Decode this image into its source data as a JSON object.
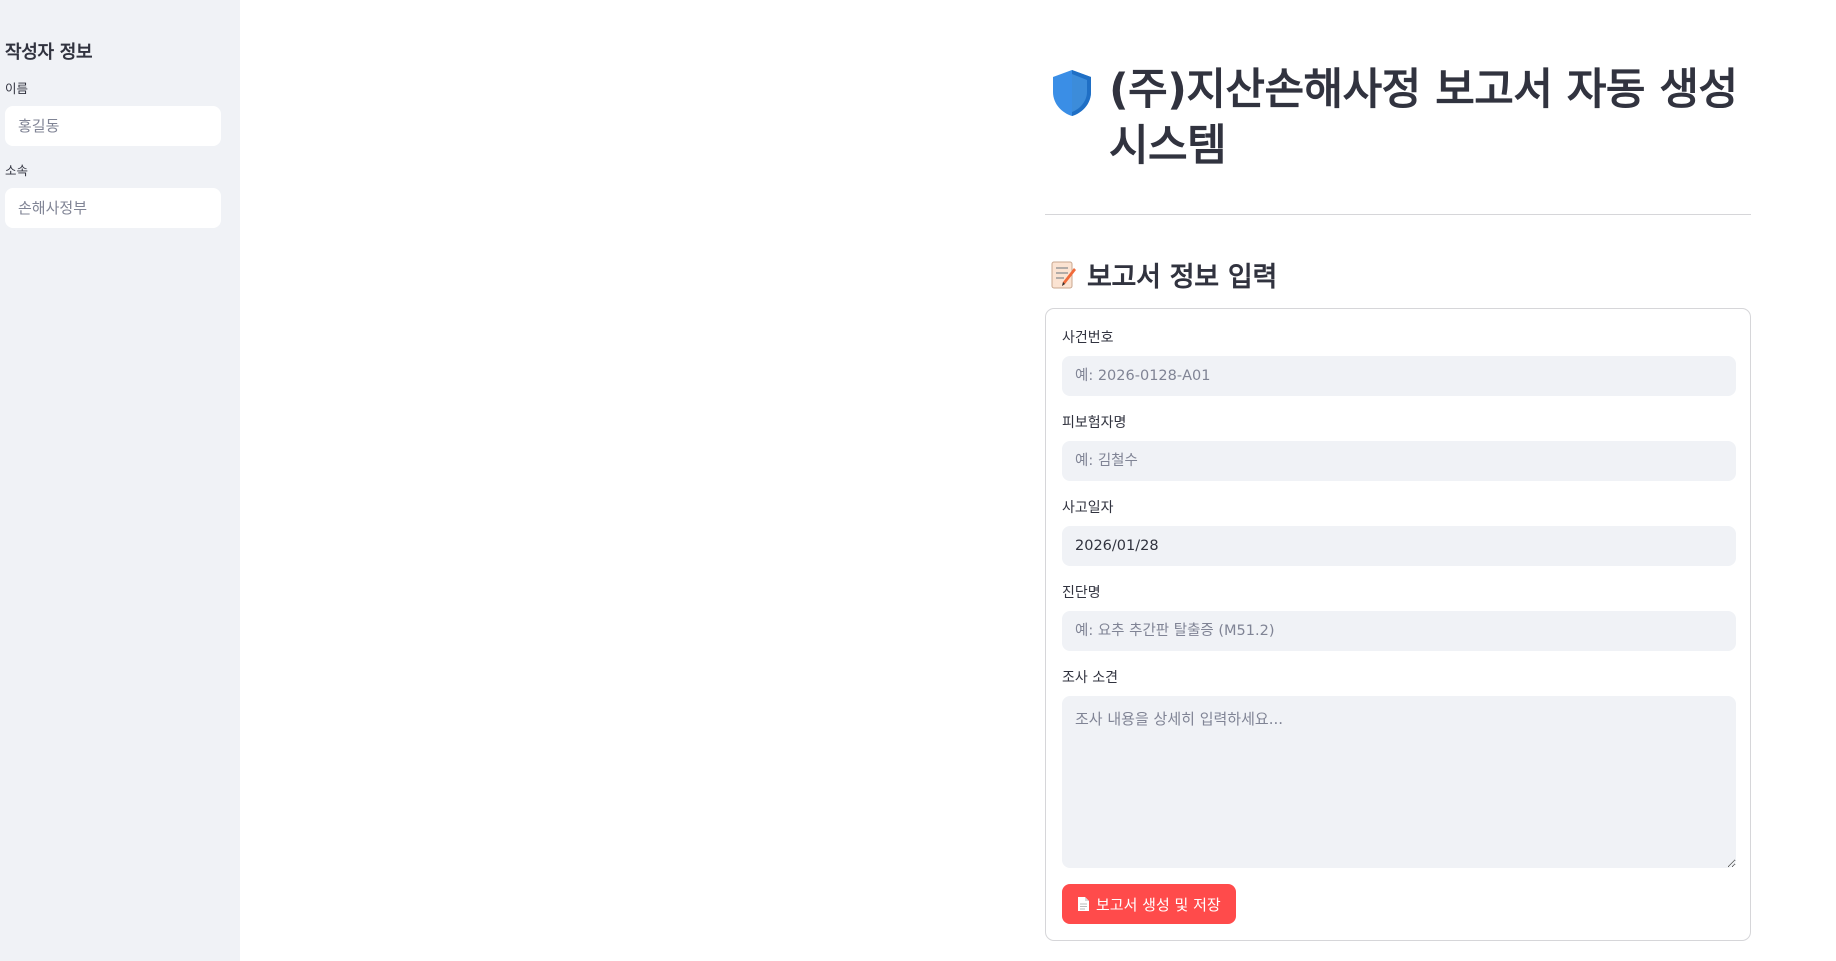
{
  "sidebar": {
    "heading": "작성자 정보",
    "name_label": "이름",
    "name_placeholder": "홍길동",
    "dept_label": "소속",
    "dept_placeholder": "손해사정부"
  },
  "main": {
    "title": "(주)지산손해사정 보고서 자동 생성 시스템",
    "title_icon": "shield-icon",
    "section_title": "보고서 정보 입력",
    "section_icon": "memo-icon"
  },
  "form": {
    "case_label": "사건번호",
    "case_placeholder": "예: 2026-0128-A01",
    "insured_label": "피보험자명",
    "insured_placeholder": "예: 김철수",
    "date_label": "사고일자",
    "date_value": "2026/01/28",
    "diagnosis_label": "진단명",
    "diagnosis_placeholder": "예: 요추 추간판 탈출증 (M51.2)",
    "opinion_label": "조사 소견",
    "opinion_placeholder": "조사 내용을 상세히 입력하세요...",
    "submit_label": "보고서 생성 및 저장",
    "submit_icon": "document-icon"
  },
  "colors": {
    "primary": "#ff4b4b",
    "sidebar_bg": "#f0f2f6",
    "input_bg": "#f0f2f6",
    "text": "#31333f",
    "placeholder": "#808495"
  }
}
